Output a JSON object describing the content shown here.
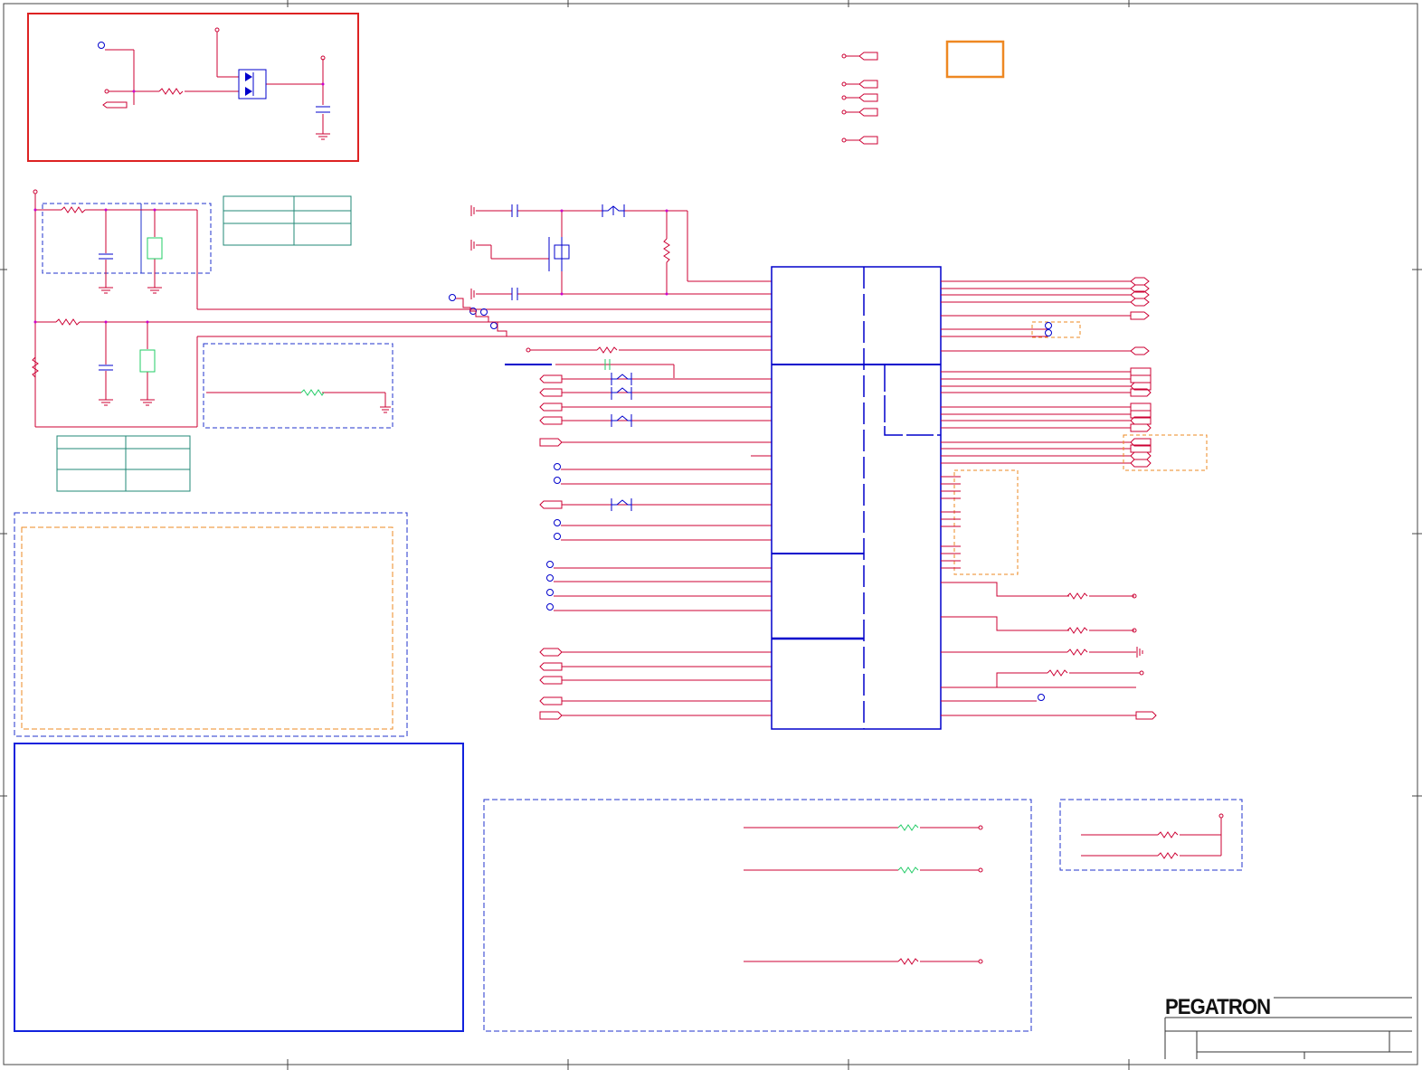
{
  "title_block": {
    "company": "PEGATRON"
  },
  "colors": {
    "wire": "#cc0033",
    "component": "#0000cc",
    "border": "#333333",
    "red_box": "#dd2222",
    "orange_box": "#ee8822",
    "teal_table": "#228877",
    "green_part": "#22cc66",
    "net_dot": "#cc00cc"
  }
}
